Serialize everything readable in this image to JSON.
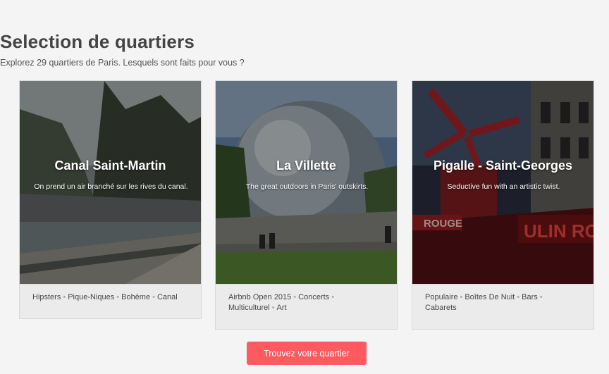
{
  "section": {
    "title": "Selection de quartiers",
    "subtitle": "Explorez 29 quartiers de Paris. Lesquels sont faits pour vous ?"
  },
  "cards": [
    {
      "name": "Canal Saint-Martin",
      "description": "On prend un air branché sur les rives du canal.",
      "tags": [
        "Hipsters",
        "Pique-Niques",
        "Bohème",
        "Canal"
      ],
      "tags_line1": [
        "Hipsters",
        "Pique-Niques",
        "Bohème",
        "Canal"
      ],
      "tags_line2": []
    },
    {
      "name": "La Villette",
      "description": "The great outdoors in Paris' outskirts.",
      "tags": [
        "Airbnb Open 2015",
        "Concerts",
        "Multiculturel",
        "Art"
      ],
      "tags_line1": [
        "Airbnb Open 2015",
        "Concerts"
      ],
      "tags_line2": [
        "Multiculturel",
        "Art"
      ]
    },
    {
      "name": "Pigalle - Saint-Georges",
      "description": "Seductive fun with an artistic twist.",
      "tags": [
        "Populaire",
        "Boîtes De Nuit",
        "Bars",
        "Cabarets"
      ],
      "tags_line1": [
        "Populaire",
        "Boîtes De Nuit",
        "Bars"
      ],
      "tags_line2": [
        "Cabarets"
      ]
    }
  ],
  "cta": {
    "label": "Trouvez votre quartier"
  },
  "colors": {
    "accent": "#ff5a5f",
    "background": "#f4f4f4",
    "tag_bar": "#ebebeb"
  },
  "tag_separator": "•",
  "image_sign_texts": [
    "ROUGE",
    "ULIN RO"
  ]
}
